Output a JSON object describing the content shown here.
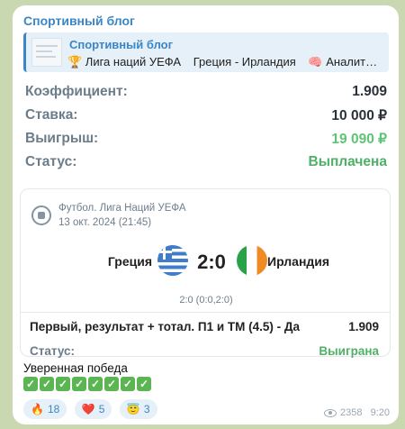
{
  "channel": {
    "name": "Спортивный блог"
  },
  "preview": {
    "title": "Спортивный блог",
    "items": [
      "🏆 Лига наций УЕФА",
      "Греция - Ирландия",
      "🧠 Аналит…"
    ]
  },
  "summary": {
    "odds_label": "Коэффициент:",
    "odds_value": "1.909",
    "stake_label": "Ставка:",
    "stake_value": "10 000 ₽",
    "win_label": "Выигрыш:",
    "win_value": "19 090 ₽",
    "status_label": "Статус:",
    "status_value": "Выплачена"
  },
  "match": {
    "league": "Футбол. Лига Наций УЕФА",
    "date": "13 окт. 2024 (21:45)",
    "team1": "Греция",
    "team2": "Ирландия",
    "score": "2:0",
    "halftime": "2:0 (0:0,2:0)",
    "bet": "Первый, результат + тотал. П1 и ТМ (4.5) - Да",
    "bet_odds": "1.909",
    "status_label": "Статус:",
    "status_value": "Выиграна"
  },
  "caption": "Уверенная победа",
  "checks": [
    "✓",
    "✓",
    "✓",
    "✓",
    "✓",
    "✓",
    "✓",
    "✓"
  ],
  "reactions": [
    {
      "emoji": "🔥",
      "count": "18"
    },
    {
      "emoji": "❤️",
      "count": "5"
    },
    {
      "emoji": "😇",
      "count": "3"
    }
  ],
  "meta": {
    "views": "2358",
    "time": "9:20"
  },
  "colors": {
    "accent": "#3b86c6",
    "win": "#5fc476",
    "status": "#4fb068"
  }
}
